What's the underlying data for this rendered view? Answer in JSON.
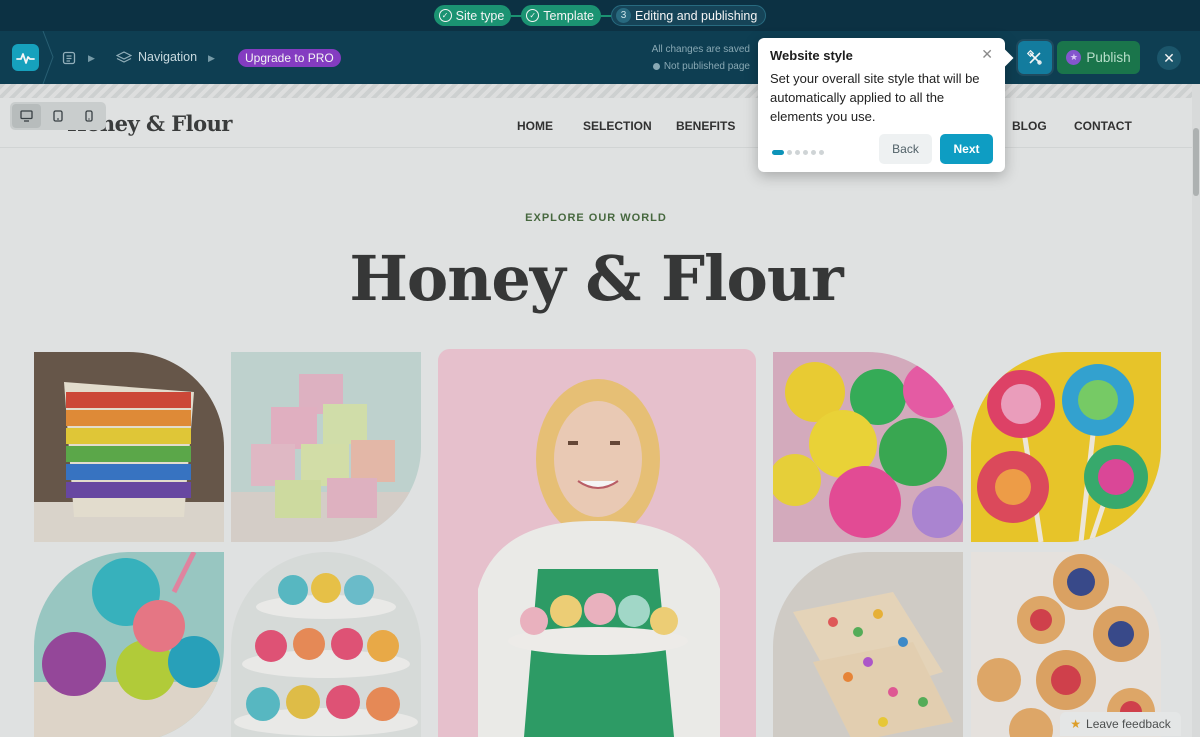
{
  "steps": [
    {
      "label": "Site type",
      "state": "done"
    },
    {
      "label": "Template",
      "state": "done"
    },
    {
      "label": "Editing and publishing",
      "state": "active",
      "number": "3"
    }
  ],
  "toolbar": {
    "breadcrumb_nav": "Navigation",
    "upgrade_label": "Upgrade to PRO",
    "status_saved": "All changes are saved",
    "status_published": "Not published page",
    "publish_label": "Publish",
    "close_icon": "close-icon",
    "style_icon": "design-tools-icon"
  },
  "devices": [
    "desktop-icon",
    "tablet-icon",
    "mobile-icon"
  ],
  "site": {
    "logo": "Honey & Flour",
    "nav": [
      "HOME",
      "SELECTION",
      "BENEFITS",
      "BLOG",
      "CONTACT"
    ],
    "eyebrow": "EXPLORE OUR WORLD",
    "hero_title": "Honey & Flour"
  },
  "popover": {
    "title": "Website style",
    "body": "Set your overall site style that will be automatically applied to all the elements you use.",
    "back_label": "Back",
    "next_label": "Next",
    "step_current": 1,
    "step_total": 6
  },
  "feedback_label": "Leave feedback",
  "colors": {
    "brand_dark": "#0f4156",
    "accent_cyan": "#0e9dc3",
    "success_green": "#1d9a77",
    "pro_purple": "#8a3fc9"
  }
}
